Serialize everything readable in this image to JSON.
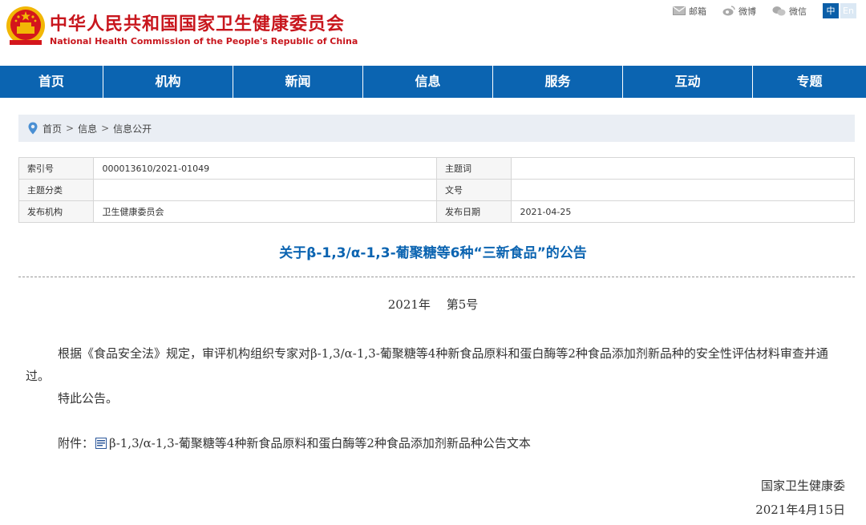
{
  "header": {
    "org_name_cn": "中华人民共和国国家卫生健康委员会",
    "org_name_en": "National Health Commission of the People's Republic of China",
    "links": [
      {
        "label": "邮箱",
        "icon": "mail-icon"
      },
      {
        "label": "微博",
        "icon": "weibo-icon"
      },
      {
        "label": "微信",
        "icon": "wechat-icon"
      }
    ],
    "lang_zh": "中",
    "lang_en": "En",
    "brand_color": "#c8161d"
  },
  "nav": {
    "color": "#0b64b1",
    "items": [
      "首页",
      "机构",
      "新闻",
      "信息",
      "服务",
      "互动",
      "专题"
    ]
  },
  "breadcrumb": {
    "icon": "location-pin-icon",
    "items": [
      "首页",
      "信息",
      "信息公开"
    ],
    "sep": ">"
  },
  "meta": {
    "index_label": "索引号",
    "index_value": "000013610/2021-01049",
    "keyword_label": "主题词",
    "keyword_value": "",
    "category_label": "主题分类",
    "category_value": "",
    "docno_label": "文号",
    "docno_value": "",
    "issuer_label": "发布机构",
    "issuer_value": "卫生健康委员会",
    "date_label": "发布日期",
    "date_value": "2021-04-25"
  },
  "article": {
    "title": "关于β-1,3/α-1,3-葡聚糖等6种“三新食品”的公告",
    "doc_number": "2021年　 第5号",
    "paragraph1": "根据《食品安全法》规定，审评机构组织专家对β-1,3/α-1,3-葡聚糖等4种新食品原料和蛋白酶等2种食品添加剂新品种的安全性评估材料审查并通过。",
    "paragraph2": "特此公告。",
    "attachment_label": "附件：",
    "attachment_icon": "word-doc-icon",
    "attachment_text": "β-1,3/α-1,3-葡聚糖等4种新食品原料和蛋白酶等2种食品添加剂新品种公告文本",
    "signature": "国家卫生健康委",
    "sign_date": "2021年4月15日"
  }
}
